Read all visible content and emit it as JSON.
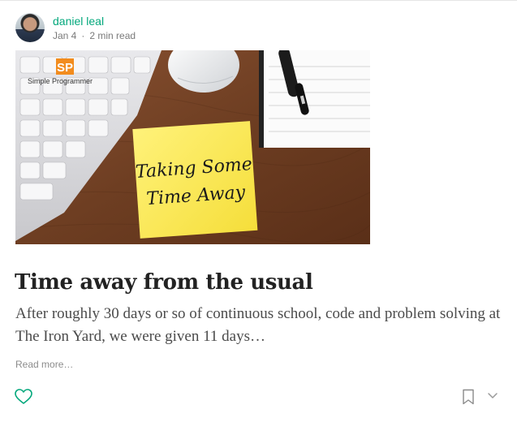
{
  "post": {
    "author": "daniel leal",
    "date": "Jan 4",
    "read_time": "2 min read",
    "title": "Time away from the usual",
    "excerpt": "After roughly 30 days or so of continuous school, code and problem solving at The Iron Yard, we were given 11 days…",
    "read_more": "Read more…"
  },
  "image": {
    "logo_text": "SP",
    "logo_caption": "Simple Programmer",
    "note_line1": "Taking Some",
    "note_line2": "Time Away"
  },
  "icons": {
    "clap": "heart-icon",
    "bookmark": "bookmark-icon",
    "more": "chevron-down-icon"
  },
  "colors": {
    "accent": "#03a87c",
    "meta": "#7a7a7a",
    "title": "#222222",
    "body": "#4b4b4b"
  }
}
